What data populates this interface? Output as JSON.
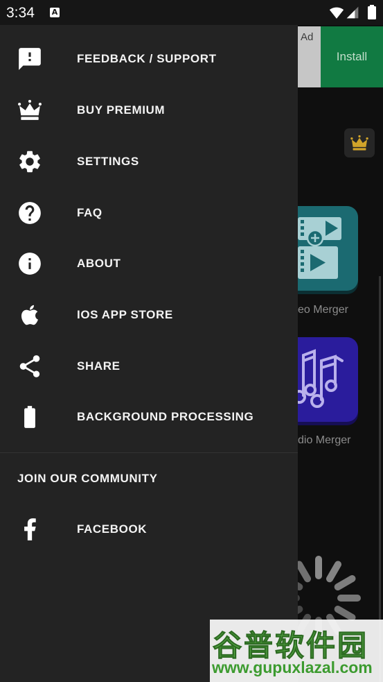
{
  "status_bar": {
    "time": "3:34",
    "notification_glyph": "A",
    "icons": [
      "a-notification-icon",
      "wifi-icon",
      "signal-icon",
      "battery-icon"
    ]
  },
  "drawer": {
    "items": [
      {
        "label": "FEEDBACK / SUPPORT",
        "icon": "feedback-icon"
      },
      {
        "label": "BUY PREMIUM",
        "icon": "crown-icon"
      },
      {
        "label": "SETTINGS",
        "icon": "gear-icon"
      },
      {
        "label": "FAQ",
        "icon": "help-circle-icon"
      },
      {
        "label": "ABOUT",
        "icon": "info-icon"
      },
      {
        "label": "IOS APP STORE",
        "icon": "apple-icon"
      },
      {
        "label": "SHARE",
        "icon": "share-icon"
      },
      {
        "label": "BACKGROUND PROCESSING",
        "icon": "battery-icon"
      }
    ],
    "community": {
      "header": "JOIN OUR COMMUNITY",
      "items": [
        {
          "label": "FACEBOOK",
          "icon": "facebook-icon"
        }
      ]
    }
  },
  "background": {
    "ad": {
      "badge": "Ad",
      "button": "Install"
    },
    "premium_icon": "crown-icon",
    "tiles": [
      {
        "caption": "eo Merger",
        "icon": "video-merger-icon"
      },
      {
        "caption": "dio Merger",
        "icon": "audio-merger-icon"
      }
    ],
    "loading_icon": "spinner-icon"
  },
  "watermark": {
    "title": "谷普软件园",
    "url": "www.gupuxlazal.com"
  },
  "colors": {
    "drawer_bg": "#232323",
    "menu_text": "#f4f4f4",
    "install_green": "#117a42",
    "video_tile": "#1b6a71",
    "audio_tile": "#2a1c9c",
    "crown_gold": "#d1a42a",
    "watermark_green": "#5bb04a"
  }
}
